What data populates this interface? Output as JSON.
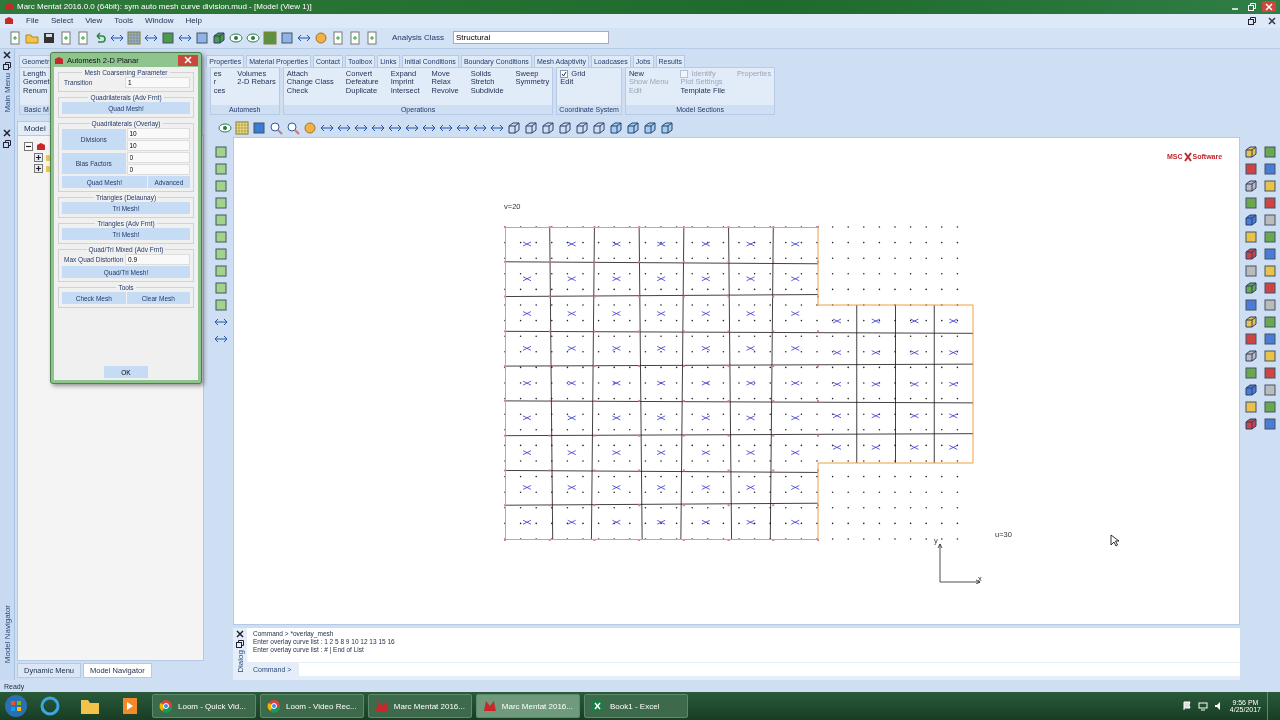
{
  "window": {
    "title": "Marc Mentat 2016.0.0 (64bit): sym auto mesh curve division.mud - [Model (View 1)]"
  },
  "menu": [
    "File",
    "Select",
    "View",
    "Tools",
    "Window",
    "Help"
  ],
  "toolbar": {
    "analysis_label": "Analysis Class",
    "analysis_value": "Structural"
  },
  "side_labels": {
    "main": "Main Menu",
    "navigator": "Model Navigator",
    "dialog": "Dialog"
  },
  "ribbon": {
    "tabs": [
      "Geometr",
      "Properties",
      "Material Properties",
      "Contact",
      "Toolbox",
      "Links",
      "Initial Conditions",
      "Boundary Conditions",
      "Mesh Adaptivity",
      "Loadcases",
      "Jobs",
      "Results"
    ],
    "groups": [
      {
        "label": "Basic M",
        "columns": [
          [
            "Length",
            "Geomet",
            "Renum"
          ]
        ]
      },
      {
        "label": "Automesh",
        "columns": [
          [
            "es",
            "r",
            "ces"
          ],
          [
            "Volumes",
            "2-D Rebars"
          ]
        ]
      },
      {
        "label": "Operations",
        "columns": [
          [
            "Attach",
            "Change Class",
            "Check"
          ],
          [
            "Convert",
            "Defeature",
            "Duplicate"
          ],
          [
            "Expand",
            "Imprint",
            "Intersect"
          ],
          [
            "Move",
            "Relax",
            "Revolve"
          ],
          [
            "Solids",
            "Stretch",
            "Subdivide"
          ],
          [
            "Sweep",
            "Symmetry"
          ]
        ]
      },
      {
        "label": "Coordinate System",
        "columns": [
          [
            {
              "kind": "check",
              "label": "Grid",
              "checked": true,
              "disabled": false
            },
            {
              "kind": "link",
              "label": "Edit",
              "disabled": false
            }
          ]
        ]
      },
      {
        "label": "Model Sections",
        "columns": [
          [
            {
              "kind": "link",
              "label": "New",
              "disabled": false
            },
            {
              "kind": "link",
              "label": "Show Menu",
              "disabled": true
            },
            {
              "kind": "link",
              "label": "Edit",
              "disabled": true
            }
          ],
          [
            {
              "kind": "check",
              "label": "Identify",
              "checked": false,
              "disabled": true
            },
            {
              "kind": "link",
              "label": "Plot Settings",
              "disabled": true
            },
            {
              "kind": "link",
              "label": "Template File",
              "disabled": false
            }
          ],
          [
            {
              "kind": "link",
              "label": "Properties",
              "disabled": true
            }
          ]
        ]
      }
    ]
  },
  "left_panel": {
    "tab": "Model",
    "tree": [
      {
        "expanded": true,
        "children": [
          {
            "expanded": false
          },
          {
            "expanded": false
          }
        ]
      }
    ],
    "bottom_tabs": [
      {
        "label": "Dynamic Menu",
        "selected": false
      },
      {
        "label": "Model Navigator",
        "selected": true
      }
    ]
  },
  "dialog": {
    "title": "Automesh 2-D Planar",
    "sections": [
      {
        "title": "Mesh Coarsening Parameter",
        "rows": [
          {
            "kind": "field",
            "label": "Transition",
            "value": "1"
          }
        ]
      },
      {
        "title": "Quadrilaterals (Adv Frnt)",
        "rows": [
          {
            "kind": "buttons",
            "labels": [
              "Quad Mesh!"
            ]
          }
        ]
      },
      {
        "title": "Quadrilaterals (Overlay)",
        "rows": [
          {
            "kind": "pair",
            "label": "Divisions",
            "values": [
              "10",
              "10"
            ]
          },
          {
            "kind": "pair",
            "label": "Bias Factors",
            "values": [
              "0",
              "0"
            ]
          },
          {
            "kind": "buttons",
            "labels": [
              "Quad Mesh!",
              "Advanced"
            ]
          }
        ]
      },
      {
        "title": "Triangles (Delaunay)",
        "rows": [
          {
            "kind": "buttons",
            "labels": [
              "Tri Mesh!"
            ]
          }
        ]
      },
      {
        "title": "Triangles (Adv Frnt)",
        "rows": [
          {
            "kind": "buttons",
            "labels": [
              "Tri Mesh!"
            ]
          }
        ]
      },
      {
        "title": "Quad/Tri Mixed (Adv Frnt)",
        "rows": [
          {
            "kind": "field",
            "label": "Max Quad Distortion",
            "value": "0.9"
          },
          {
            "kind": "buttons",
            "labels": [
              "Quad/Tri Mesh!"
            ]
          }
        ]
      },
      {
        "title": "Tools",
        "rows": [
          {
            "kind": "buttons",
            "labels": [
              "Check Mesh",
              "Clear Mesh"
            ]
          }
        ]
      }
    ],
    "ok": "OK"
  },
  "viewport": {
    "v_label": "v=20",
    "u_label": "u=30",
    "axis_x": "x",
    "axis_y": "y",
    "logo": [
      "MSC",
      "Software"
    ]
  },
  "command": {
    "lines": [
      "Command > *overlay_mesh",
      "Enter overlay curve list :  1 2 5 8 9 10 12 13 15 16",
      "Enter overlay curve list : # | End of List"
    ],
    "prompt": "Command >"
  },
  "status_bar": "Ready",
  "taskbar": {
    "tasks": [
      {
        "kind": "chrome",
        "label": "Loom - Quick Vid...",
        "selected": false
      },
      {
        "kind": "chrome",
        "label": "Loom - Video Rec...",
        "selected": false
      },
      {
        "kind": "mentat",
        "label": "Marc Mentat 2016...",
        "selected": false
      },
      {
        "kind": "mentat",
        "label": "Marc Mentat 2016...",
        "selected": true
      },
      {
        "kind": "excel",
        "label": "Book1 - Excel",
        "selected": false
      }
    ],
    "time": "9:56 PM",
    "date": "4/25/2017"
  }
}
